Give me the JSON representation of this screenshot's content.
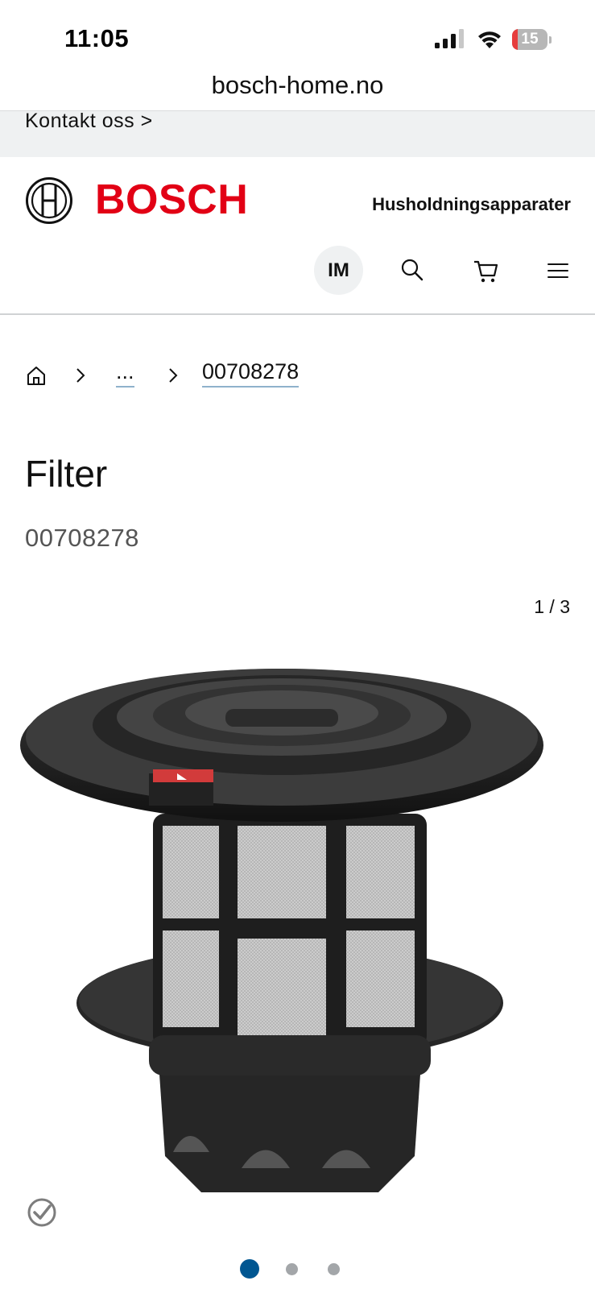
{
  "status_bar": {
    "time": "11:05",
    "battery": "15",
    "battery_level": 0.15
  },
  "browser": {
    "url": "bosch-home.no"
  },
  "contact": {
    "label": "Kontakt oss >"
  },
  "header": {
    "brand": "BOSCH",
    "category": "Husholdningsapparater",
    "avatar_initials": "IM",
    "icons": [
      "search-icon",
      "cart-icon",
      "menu-icon"
    ]
  },
  "breadcrumb": {
    "items": [
      "home-icon",
      "...",
      "00708278"
    ]
  },
  "product": {
    "title": "Filter",
    "code": "00708278"
  },
  "gallery": {
    "counter": "1 / 3",
    "current": 1,
    "total": 3
  },
  "colors": {
    "brand_red": "#e20015",
    "active_dot": "#005691",
    "inactive_dot": "#a3a6a9",
    "strip_bg": "#eff1f2"
  }
}
